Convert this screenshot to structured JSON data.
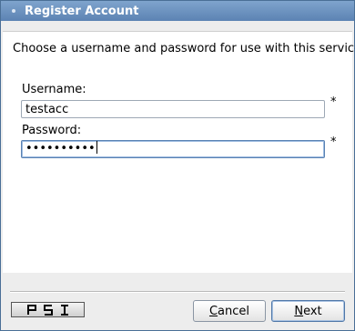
{
  "window": {
    "title": "Register Account"
  },
  "intro_text": "Choose a username and password for use with this service.",
  "form": {
    "username": {
      "label": "Username:",
      "value": "testacc",
      "required_mark": "*"
    },
    "password": {
      "label": "Password:",
      "value": "••••••••••",
      "required_mark": "*"
    }
  },
  "logo": {
    "text": "PSI",
    "icon": "psi-logo"
  },
  "buttons": {
    "cancel": {
      "mnemonic": "C",
      "rest": "ancel"
    },
    "next": {
      "mnemonic": "N",
      "rest": "ext"
    }
  }
}
